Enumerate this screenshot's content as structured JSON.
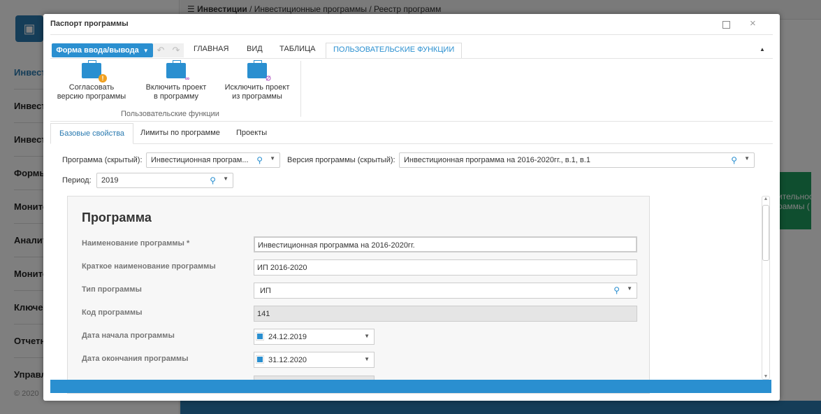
{
  "background": {
    "breadcrumb": [
      "Инвестиции",
      "Инвестиционные программы",
      "Реестр программ"
    ],
    "sidebar": [
      "Инвест",
      "Инвест",
      "Инвест",
      "Формы",
      "Монито",
      "Аналит",
      "Монито",
      "Ключев",
      "Отчетн",
      "Управл"
    ],
    "footer": "© 2020",
    "green_tile": "ительнос\nраммы ("
  },
  "modal": {
    "title": "Паспорт программы",
    "form_button": "Форма ввода/вывода",
    "ribbon_tabs": [
      "ГЛАВНАЯ",
      "ВИД",
      "ТАБЛИЦА",
      "ПОЛЬЗОВАТЕЛЬСКИЕ ФУНКЦИИ"
    ],
    "ribbon_buttons": [
      {
        "line1": "Согласовать",
        "line2": "версию программы"
      },
      {
        "line1": "Включить проект",
        "line2": "в программу"
      },
      {
        "line1": "Исключить проект",
        "line2": "из программы"
      }
    ],
    "ribbon_group": "Пользовательские функции",
    "form_tabs": [
      "Базовые свойства",
      "Лимиты по программе",
      "Проекты"
    ],
    "filters": {
      "program_label": "Программа (скрытый):",
      "program_value": "Инвестиционная програм...",
      "version_label": "Версия программы (скрытый):",
      "version_value": "Инвестиционная программа на 2016-2020гг., в.1, в.1",
      "period_label": "Период:",
      "period_value": "2019"
    },
    "panel": {
      "title": "Программа",
      "fields": [
        {
          "label": "Наименование программы *",
          "value": "Инвестиционная программа на 2016-2020гг."
        },
        {
          "label": "Краткое наименование программы",
          "value": "ИП 2016-2020"
        },
        {
          "label": "Тип программы",
          "value": "ИП"
        },
        {
          "label": "Код программы",
          "value": "141"
        },
        {
          "label": "Дата начала программы",
          "value": "24.12.2019"
        },
        {
          "label": "Дата окончания программы",
          "value": "31.12.2020"
        }
      ]
    }
  }
}
